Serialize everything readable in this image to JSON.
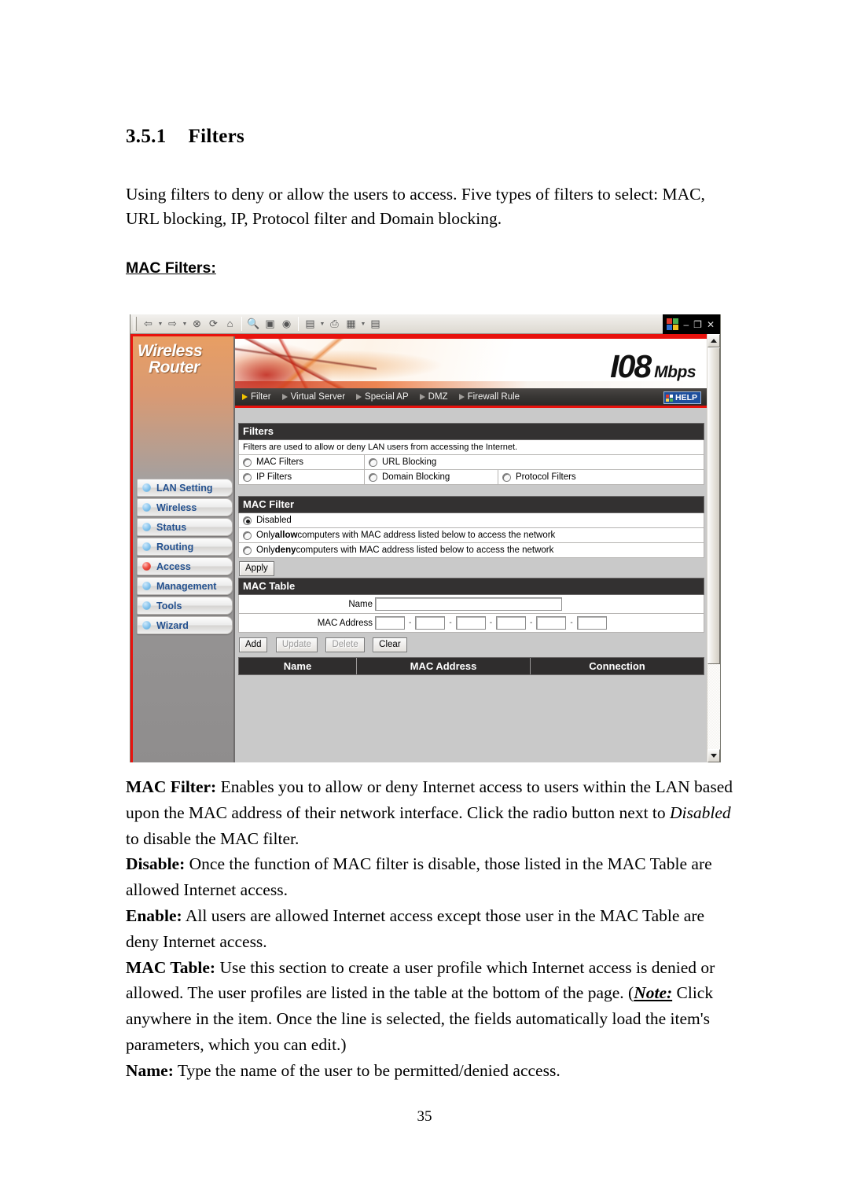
{
  "document": {
    "section_number": "3.5.1",
    "section_title": "Filters",
    "intro_paragraph": "Using filters to deny or allow the users to access.    Five types of filters to select: MAC, URL blocking, IP, Protocol filter and Domain blocking.",
    "sub_heading": "MAC Filters:",
    "page_number": "35",
    "body": {
      "mac_filter_label": "MAC Filter:",
      "mac_filter_text_1": " Enables you to allow or deny Internet access to users within the LAN based upon the MAC address of their network interface. Click the radio button next to ",
      "mac_filter_italic": "Disabled",
      "mac_filter_text_2": " to disable the MAC filter.",
      "disable_label": "Disable:",
      "disable_text": " Once the function of MAC filter is disable, those listed in the MAC Table are allowed Internet access.",
      "enable_label": "Enable:",
      "enable_text": " All users are allowed Internet access except those user in the MAC Table are deny Internet access.",
      "mac_table_label": "MAC Table:",
      "mac_table_text_1": " Use this section to create a user profile which Internet access is denied or allowed.    The user profiles are listed in the table at the bottom of the page.   (",
      "mac_table_note": "Note:",
      "mac_table_text_2": " Click anywhere in the item. Once the line is selected, the fields automatically load the item's parameters, which you can edit.)",
      "name_label": "Name:",
      "name_text": " Type the name of the user to be permitted/denied access."
    }
  },
  "browser": {
    "toolbar": {
      "back": "back-icon",
      "forward": "forward-icon",
      "stop": "stop-icon",
      "refresh": "refresh-icon",
      "home": "home-icon",
      "search": "search-icon",
      "favorites": "favorites-icon",
      "media": "media-icon",
      "history": "history-icon",
      "print": "print-icon",
      "edit": "edit-icon",
      "discuss": "discuss-icon"
    },
    "window_controls": {
      "minimize": "–",
      "restore": "❐",
      "close": "✕"
    }
  },
  "router": {
    "brand_line1": "Wireless",
    "brand_line2": "Router",
    "banner": {
      "speed_number": "I08",
      "speed_unit": "Mbps"
    },
    "nav": [
      {
        "label": "Filter",
        "active": true
      },
      {
        "label": "Virtual Server",
        "active": false
      },
      {
        "label": "Special AP",
        "active": false
      },
      {
        "label": "DMZ",
        "active": false
      },
      {
        "label": "Firewall Rule",
        "active": false
      }
    ],
    "help_label": "HELP",
    "sidebar": [
      {
        "label": "LAN Setting",
        "active": false
      },
      {
        "label": "Wireless",
        "active": false
      },
      {
        "label": "Status",
        "active": false
      },
      {
        "label": "Routing",
        "active": false
      },
      {
        "label": "Access",
        "active": true
      },
      {
        "label": "Management",
        "active": false
      },
      {
        "label": "Tools",
        "active": false
      },
      {
        "label": "Wizard",
        "active": false
      }
    ],
    "filters_panel": {
      "title": "Filters",
      "description": "Filters are used to allow or deny LAN users from accessing the Internet.",
      "options_row1": [
        {
          "label": "MAC Filters",
          "selected": false
        },
        {
          "label": "URL Blocking",
          "selected": false
        }
      ],
      "options_row2": [
        {
          "label": "IP Filters",
          "selected": false
        },
        {
          "label": "Domain Blocking",
          "selected": false
        },
        {
          "label": "Protocol Filters",
          "selected": false
        }
      ]
    },
    "mac_filter_panel": {
      "title": "MAC Filter",
      "options": [
        {
          "pre": "Disabled",
          "bold": "",
          "post": "",
          "selected": true
        },
        {
          "pre": "Only ",
          "bold": "allow",
          "post": " computers with MAC address listed below to access the network",
          "selected": false
        },
        {
          "pre": "Only ",
          "bold": "deny",
          "post": " computers with MAC address listed below to access the network",
          "selected": false
        }
      ],
      "apply_label": "Apply"
    },
    "mac_table_panel": {
      "title": "MAC Table",
      "name_label": "Name",
      "name_value": "",
      "mac_address_label": "MAC Address",
      "mac_octets": [
        "",
        "",
        "",
        "",
        "",
        ""
      ],
      "octet_separator": "-",
      "buttons": [
        {
          "label": "Add",
          "disabled": false
        },
        {
          "label": "Update",
          "disabled": true
        },
        {
          "label": "Delete",
          "disabled": true
        },
        {
          "label": "Clear",
          "disabled": false
        }
      ],
      "table_headers": [
        "Name",
        "MAC Address",
        "Connection"
      ]
    }
  },
  "colors": {
    "accent_red": "#e8120d",
    "panel_dark": "#333131",
    "menu_blue": "#24518f",
    "help_blue": "#1e4f9c"
  }
}
